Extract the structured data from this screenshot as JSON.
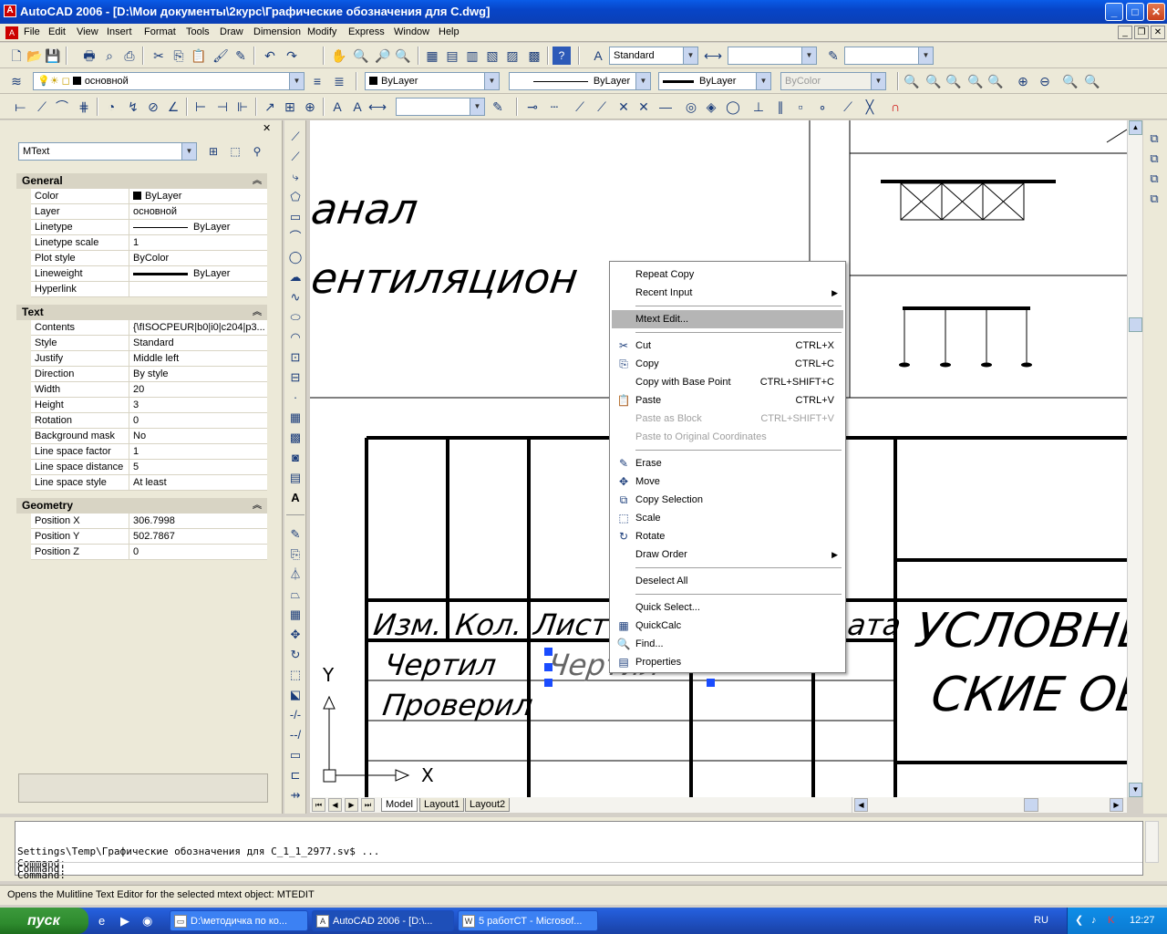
{
  "window": {
    "title": "AutoCAD 2006 - [D:\\Мои документы\\2курс\\Графические обозначения для С.dwg]",
    "minimize": "_",
    "maximize": "□",
    "close": "✕"
  },
  "menubar": [
    "File",
    "Edit",
    "View",
    "Insert",
    "Format",
    "Tools",
    "Draw",
    "Dimension",
    "Modify",
    "Express",
    "Window",
    "Help"
  ],
  "toolbar1": {
    "text_style": "Standard",
    "dim_style": "",
    "plot_style": ""
  },
  "toolbar2": {
    "layer": "основной",
    "color": "ByLayer",
    "linetype": "ByLayer",
    "lineweight": "ByLayer",
    "plotstyle": "ByColor"
  },
  "toolbar3": {
    "dim_combo": ""
  },
  "properties": {
    "selection": "MText",
    "general_title": "General",
    "general": [
      {
        "k": "Color",
        "v": "ByLayer",
        "swatch": "solid"
      },
      {
        "k": "Layer",
        "v": "основной"
      },
      {
        "k": "Linetype",
        "v": "ByLayer",
        "swatch": "line"
      },
      {
        "k": "Linetype scale",
        "v": "1"
      },
      {
        "k": "Plot style",
        "v": "ByColor"
      },
      {
        "k": "Lineweight",
        "v": "ByLayer",
        "swatch": "thick"
      },
      {
        "k": "Hyperlink",
        "v": ""
      }
    ],
    "text_title": "Text",
    "text": [
      {
        "k": "Contents",
        "v": "{\\fISOCPEUR|b0|i0|c204|p3..."
      },
      {
        "k": "Style",
        "v": "Standard"
      },
      {
        "k": "Justify",
        "v": "Middle left"
      },
      {
        "k": "Direction",
        "v": "By style"
      },
      {
        "k": "Width",
        "v": "20"
      },
      {
        "k": "Height",
        "v": "3"
      },
      {
        "k": "Rotation",
        "v": "0"
      },
      {
        "k": "Background mask",
        "v": "No"
      },
      {
        "k": "Line space factor",
        "v": "1"
      },
      {
        "k": "Line space distance",
        "v": "5"
      },
      {
        "k": "Line space style",
        "v": "At least"
      }
    ],
    "geometry_title": "Geometry",
    "geometry": [
      {
        "k": "Position X",
        "v": "306.7998"
      },
      {
        "k": "Position Y",
        "v": "502.7867"
      },
      {
        "k": "Position Z",
        "v": "0"
      }
    ]
  },
  "drawing": {
    "text_anal": "анал",
    "text_vent": "ентиляцион",
    "hdr_izm": "Изм.",
    "hdr_kol": "Кол.",
    "hdr_list": "Лист",
    "hdr_data": "ата",
    "row_chertil": "Чертил",
    "row_proveril": "Проверил",
    "sel_text": "Чертил",
    "title1": "УСЛОВНЫ",
    "title2": "СКИЕ ОБ",
    "ucs_x": "X",
    "ucs_y": "Y"
  },
  "tabs": [
    "Model",
    "Layout1",
    "Layout2"
  ],
  "context_menu": [
    {
      "label": "Repeat Copy",
      "type": "item"
    },
    {
      "label": "Recent Input",
      "type": "submenu"
    },
    {
      "type": "sep"
    },
    {
      "label": "Mtext Edit...",
      "type": "item",
      "highlight": true
    },
    {
      "type": "sep"
    },
    {
      "label": "Cut",
      "shortcut": "CTRL+X",
      "icon": "scissors-icon",
      "type": "item"
    },
    {
      "label": "Copy",
      "shortcut": "CTRL+C",
      "icon": "copy-icon",
      "type": "item"
    },
    {
      "label": "Copy with Base Point",
      "shortcut": "CTRL+SHIFT+C",
      "type": "item"
    },
    {
      "label": "Paste",
      "shortcut": "CTRL+V",
      "icon": "paste-icon",
      "type": "item"
    },
    {
      "label": "Paste as Block",
      "shortcut": "CTRL+SHIFT+V",
      "type": "item",
      "disabled": true
    },
    {
      "label": "Paste to Original Coordinates",
      "type": "item",
      "disabled": true
    },
    {
      "type": "sep"
    },
    {
      "label": "Erase",
      "icon": "eraser-icon",
      "type": "item"
    },
    {
      "label": "Move",
      "icon": "move-icon",
      "type": "item"
    },
    {
      "label": "Copy Selection",
      "icon": "copy-selection-icon",
      "type": "item"
    },
    {
      "label": "Scale",
      "icon": "scale-icon",
      "type": "item"
    },
    {
      "label": "Rotate",
      "icon": "rotate-icon",
      "type": "item"
    },
    {
      "label": "Draw Order",
      "type": "submenu"
    },
    {
      "type": "sep"
    },
    {
      "label": "Deselect All",
      "type": "item"
    },
    {
      "type": "sep"
    },
    {
      "label": "Quick Select...",
      "type": "item"
    },
    {
      "label": "QuickCalc",
      "icon": "calculator-icon",
      "type": "item"
    },
    {
      "label": "Find...",
      "icon": "find-icon",
      "type": "item"
    },
    {
      "label": "Properties",
      "icon": "properties-icon",
      "type": "item"
    }
  ],
  "command": {
    "history": "Settings\\Temp\\Графические обозначения для С_1_1_2977.sv$ ...\nCommand:\nCommand:",
    "prompt": "Command:"
  },
  "status": "Opens the Mulitline Text Editor for the selected mtext object:  MTEDIT",
  "taskbar": {
    "start": "пуск",
    "tasks": [
      {
        "label": "D:\\методичка по ко...",
        "active": false
      },
      {
        "label": "AutoCAD 2006 - [D:\\...",
        "active": true
      },
      {
        "label": "5 работСТ - Microsof...",
        "active": false
      }
    ],
    "lang": "RU",
    "clock": "12:27"
  }
}
